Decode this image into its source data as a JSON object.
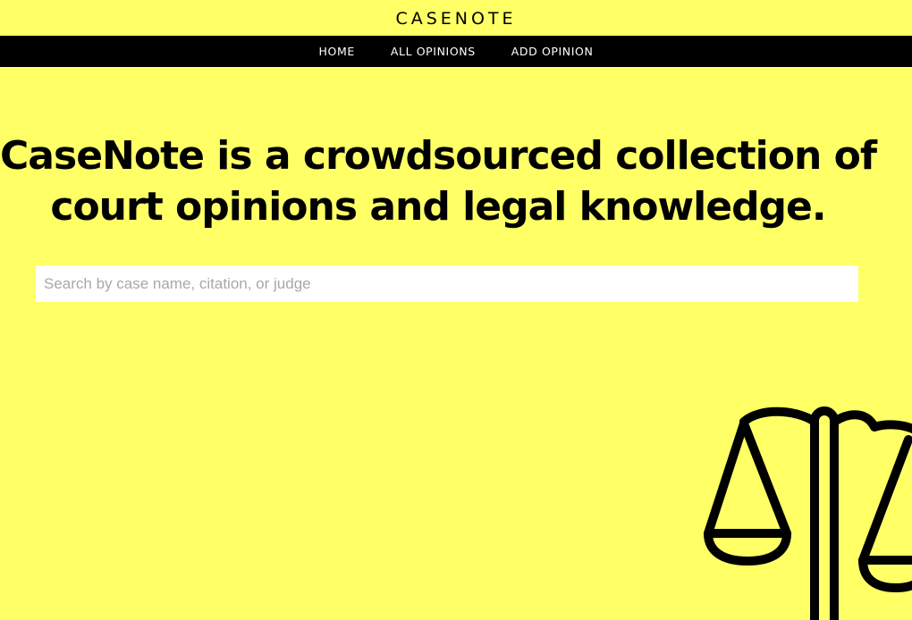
{
  "brand": {
    "name": "CASENOTE"
  },
  "nav": {
    "items": [
      {
        "label": "HOME"
      },
      {
        "label": "ALL OPINIONS"
      },
      {
        "label": "ADD OPINION"
      }
    ]
  },
  "hero": {
    "headline_line1": "CaseNote is a crowdsourced collection of",
    "headline_line2": "court opinions and legal knowledge."
  },
  "search": {
    "placeholder": "Search by case name, citation, or judge",
    "value": ""
  },
  "decoration": {
    "icon": "scales-of-justice-icon"
  },
  "colors": {
    "background": "#ffff66",
    "nav_background": "#000000",
    "nav_text": "#ffffff",
    "text": "#000000"
  }
}
